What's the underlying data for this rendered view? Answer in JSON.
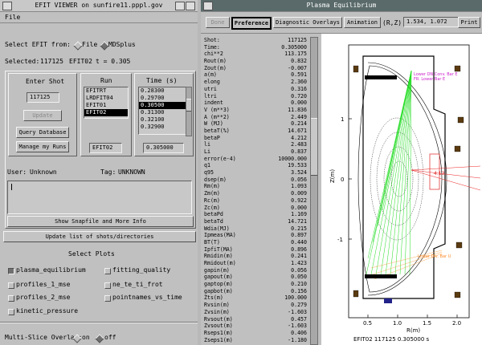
{
  "left_window": {
    "title": "EFIT VIEWER on sunfire11.pppl.gov",
    "menu_file": "File",
    "select_efit_from": "Select EFIT from:",
    "source_file": "File",
    "source_mdsplus": "MDSplus",
    "selected_label": "Selected:",
    "selected_shot": "117125",
    "selected_run": "EFIT02",
    "selected_time": "t = 0.305",
    "enter_shot_label": "Enter Shot",
    "shot_value": "117125",
    "update_button": "Update",
    "query_button": "Query Database",
    "manage_button": "Manage my Runs",
    "run_header": "Run",
    "runs": [
      "EFITRT",
      "LRDFIT04",
      "EFIT01",
      "EFIT02"
    ],
    "run_selected_value": "EFIT02",
    "time_header": "Time (s)",
    "times": [
      "0.28300",
      "0.29700",
      "0.30500",
      "0.31300",
      "0.32100",
      "0.32900"
    ],
    "time_selected_value": "0.305000",
    "user_label": "User:",
    "user_value": "Unknown",
    "tag_label": "Tag:",
    "tag_value": "UNKNOWN",
    "show_snapfile": "Show Snapfile and More Info",
    "update_list": "Update list of shots/directories",
    "select_plots_label": "Select Plots",
    "plots": {
      "plasma_equilibrium": "plasma_equilibrium",
      "fitting_quality": "fitting_quality",
      "profiles_1_mse": "profiles_1_mse",
      "ne_te_ti_frot": "ne_te_ti_frot",
      "profiles_2_mse": "profiles_2_mse",
      "pointnames_vs_time": "pointnames_vs_time",
      "kinetic_pressure": "kinetic_pressure"
    },
    "multi_slice_label": "Multi-Slice Overlay:",
    "multi_on": "on",
    "multi_off": "off"
  },
  "right_window": {
    "title": "Plasma Equilibrium",
    "toolbar": {
      "done": "Done",
      "preference": "Preference",
      "diagnostic": "Diagnostic Overlays",
      "animation": "Animation",
      "rz_label": "(R,Z)",
      "rz_value": "1.534, 1.072",
      "print": "Print"
    },
    "params": [
      [
        "Shot:",
        "117125"
      ],
      [
        "Time:",
        "0.305000"
      ],
      [
        "chi**2",
        "113.175"
      ],
      [
        "Rout(m)",
        "0.832"
      ],
      [
        "Zout(m)",
        "-0.007"
      ],
      [
        "a(m)",
        "0.591"
      ],
      [
        "elong",
        "2.360"
      ],
      [
        "utri",
        "0.316"
      ],
      [
        "ltri",
        "0.720"
      ],
      [
        "indent",
        "0.000"
      ],
      [
        "V (m**3)",
        "11.836"
      ],
      [
        "A (m**2)",
        "2.449"
      ],
      [
        "W (MJ)",
        "0.214"
      ],
      [
        "betaT(%)",
        "14.671"
      ],
      [
        "betaP",
        "4.212"
      ],
      [
        "li",
        "2.483"
      ],
      [
        "Li",
        "0.837"
      ],
      [
        "error(e-4)",
        "10000.000"
      ],
      [
        "q1",
        "19.533"
      ],
      [
        "q95",
        "3.524"
      ],
      [
        "dsep(m)",
        "0.056"
      ],
      [
        "Rm(m)",
        "1.093"
      ],
      [
        "Zm(m)",
        "0.009"
      ],
      [
        "Rc(m)",
        "0.922"
      ],
      [
        "Zc(m)",
        "0.000"
      ],
      [
        "betaPd",
        "1.169"
      ],
      [
        "betaTd",
        "14.721"
      ],
      [
        "Wdia(MJ)",
        "0.215"
      ],
      [
        "Ipmeas(MA)",
        "0.897"
      ],
      [
        "BT(T)",
        "0.440"
      ],
      [
        "IpfiT(MA)",
        "0.896"
      ],
      [
        "Rmidin(m)",
        "0.241"
      ],
      [
        "Rmidout(m)",
        "1.423"
      ],
      [
        "gapin(m)",
        "0.056"
      ],
      [
        "gapout(m)",
        "0.050"
      ],
      [
        "gaptop(m)",
        "0.210"
      ],
      [
        "gapbot(m)",
        "0.156"
      ],
      [
        "Zts(m)",
        "100.000"
      ],
      [
        "Rvsin(m)",
        "0.279"
      ],
      [
        "Zvsin(m)",
        "-1.603"
      ],
      [
        "Rvsout(m)",
        "0.457"
      ],
      [
        "Zvsout(m)",
        "-1.603"
      ],
      [
        "Rseps1(m)",
        "0.406"
      ],
      [
        "Zseps1(m)",
        "-1.180"
      ]
    ],
    "plot": {
      "ylabel": "Z(m)",
      "xlabel": "R(m)",
      "yticks": [
        "1",
        "0",
        "-1"
      ],
      "xticks": [
        "0.5",
        "1.0",
        "1.5",
        "2.0"
      ],
      "annot_top": "Lower DN Conv. Bar E",
      "annot_top2": "FR. Lower Bar E",
      "annot_mid": "4.13",
      "annot_bot": "Lower Div. Bar U",
      "caption": "EFIT02  117125  0.305000  s"
    }
  }
}
